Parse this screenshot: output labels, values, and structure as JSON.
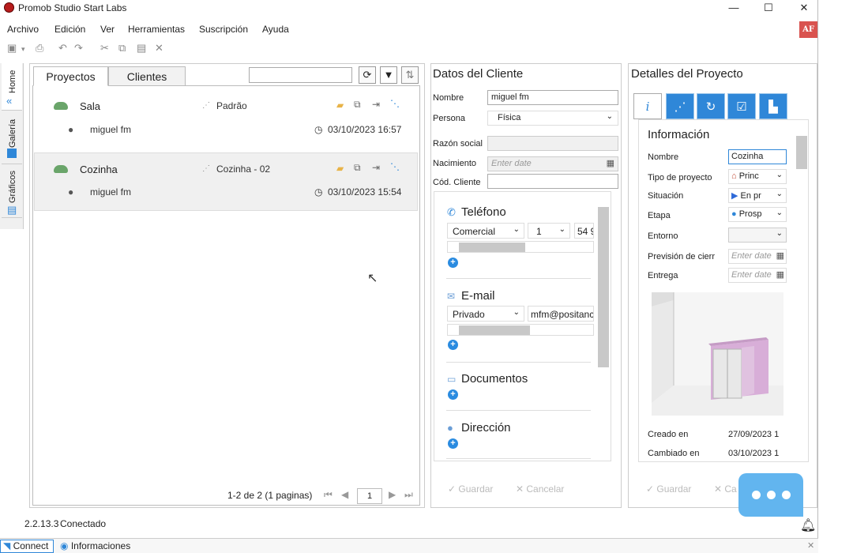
{
  "window": {
    "title": "Promob Studio Start Labs",
    "user_initials": "AF"
  },
  "menu": [
    "Archivo",
    "Edición",
    "Ver",
    "Herramientas",
    "Suscripción",
    "Ayuda"
  ],
  "left_tabs": [
    "Home",
    "Galería",
    "Gráficos"
  ],
  "projects": {
    "tabs": [
      "Proyectos",
      "Clientes"
    ],
    "search_value": "",
    "rows": [
      {
        "name": "Sala",
        "environment": "Padrão",
        "owner": "miguel fm",
        "date": "03/10/2023 16:57"
      },
      {
        "name": "Cozinha",
        "environment": "Cozinha - 02",
        "owner": "miguel fm",
        "date": "03/10/2023 15:54"
      }
    ],
    "pager_text": "1-2 de 2 (1 paginas)",
    "page_number": "1"
  },
  "client": {
    "title": "Datos del Cliente",
    "nombre_label": "Nombre",
    "nombre_value": "miguel fm",
    "persona_label": "Persona",
    "persona_value": "Física",
    "razon_label": "Razón social",
    "nacimiento_label": "Nacimiento",
    "nacimiento_placeholder": "Enter date",
    "codigo_label": "Cód. Cliente",
    "telefono_title": "Teléfono",
    "telefono_type": "Comercial",
    "telefono_code": "1",
    "telefono_number": "54 9",
    "email_title": "E-mail",
    "email_type": "Privado",
    "email_value": "mfm@positanc",
    "documentos_title": "Documentos",
    "direccion_title": "Dirección",
    "save_label": "Guardar",
    "cancel_label": "Cancelar"
  },
  "details": {
    "title": "Detalles del Proyecto",
    "section_title": "Información",
    "nombre_label": "Nombre",
    "nombre_value": "Cozinha",
    "tipo_label": "Tipo de proyecto",
    "tipo_value": "Princ",
    "situacion_label": "Situación",
    "situacion_value": "En pr",
    "etapa_label": "Etapa",
    "etapa_value": "Prosp",
    "entorno_label": "Entorno",
    "prevision_label": "Previsión de cierr",
    "prevision_placeholder": "Enter date",
    "entrega_label": "Entrega",
    "entrega_placeholder": "Enter date",
    "creado_label": "Creado en",
    "creado_value": "27/09/2023 1",
    "cambiado_label": "Cambiado en",
    "cambiado_value": "03/10/2023 1",
    "save_label": "Guardar",
    "cancel_label": "Ca"
  },
  "status": {
    "version": "2.2.13.3",
    "state": "Conectado",
    "connect_label": "Connect",
    "info_label": "Informaciones"
  }
}
